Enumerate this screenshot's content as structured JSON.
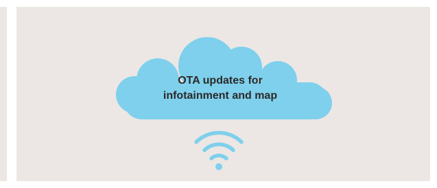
{
  "cloud": {
    "label_line1": "OTA updates for",
    "label_line2": "infotainment and map",
    "color": "#7fd0ec"
  },
  "wifi_icon": {
    "name": "wifi-icon",
    "color": "#7fd0ec"
  },
  "background": {
    "panel_color": "#ece7e4",
    "page_color": "#ffffff"
  }
}
